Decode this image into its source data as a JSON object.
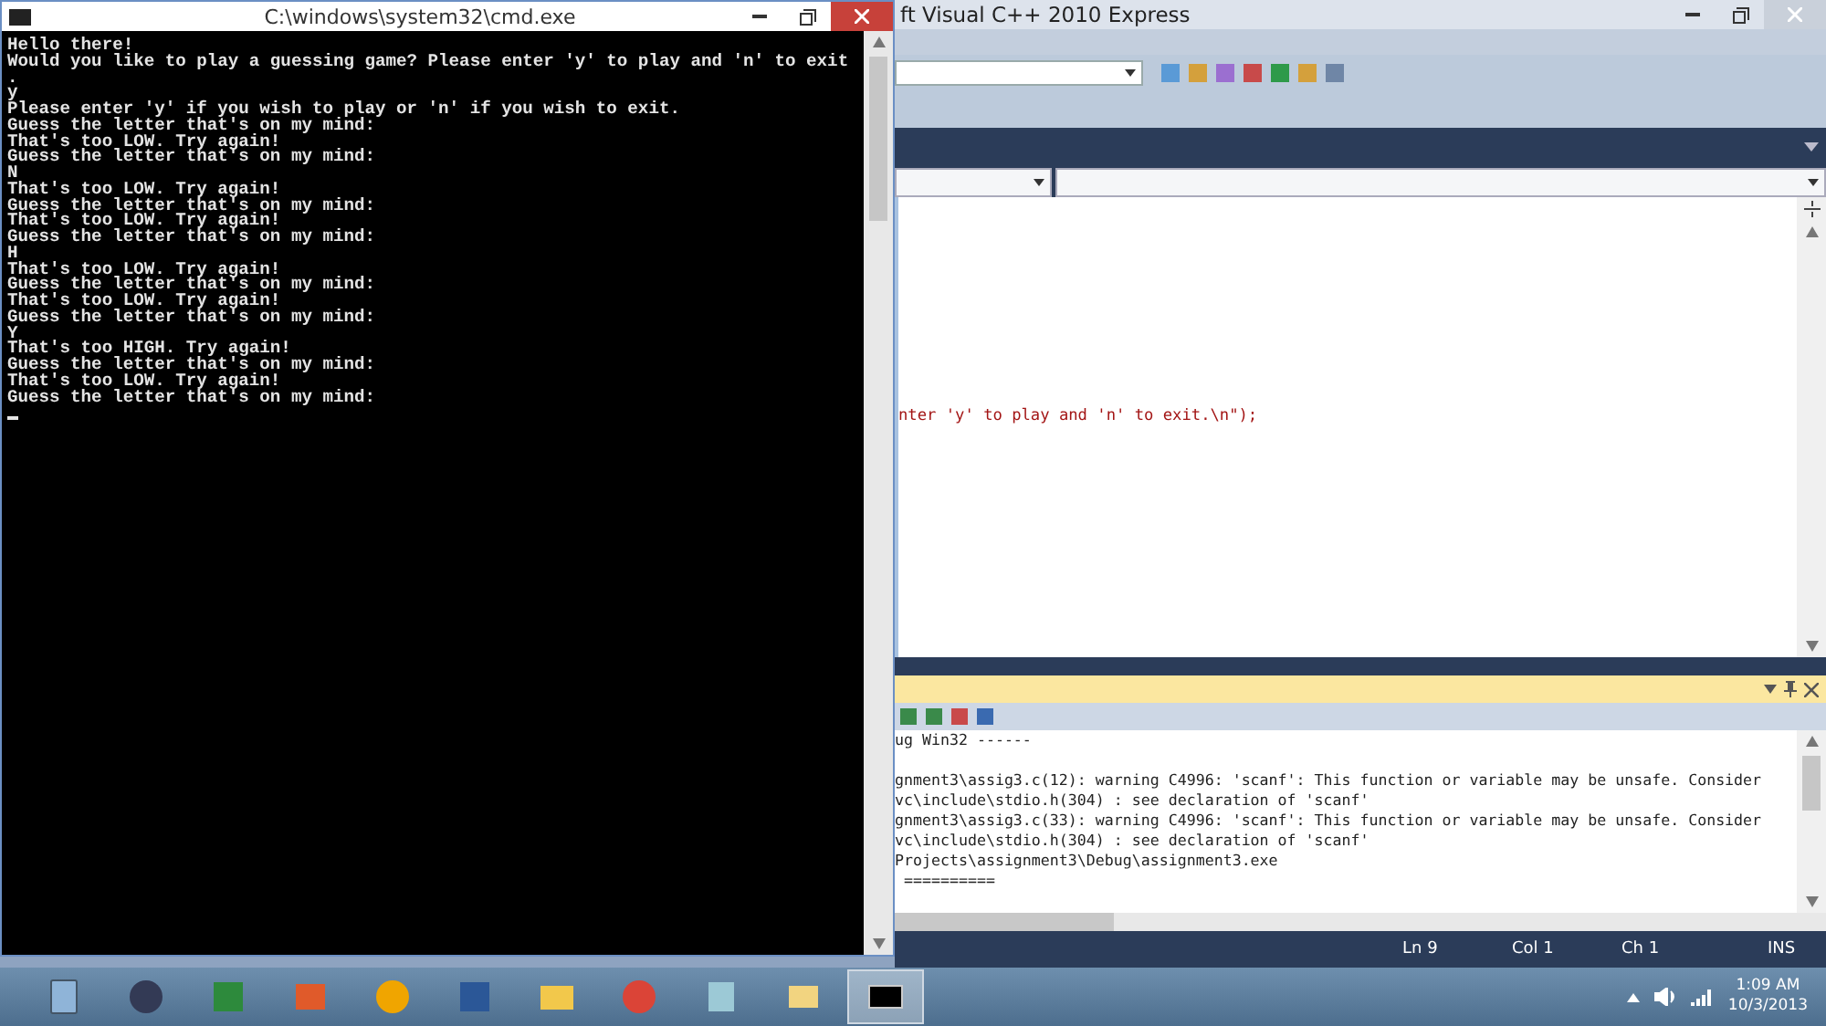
{
  "console_window": {
    "title": "C:\\windows\\system32\\cmd.exe",
    "lines": [
      "Hello there!",
      "Would you like to play a guessing game? Please enter 'y' to play and 'n' to exit",
      ".",
      "y",
      "Please enter 'y' if you wish to play or 'n' if you wish to exit.",
      "Guess the letter that's on my mind:",
      "That's too LOW. Try again!",
      "Guess the letter that's on my mind:",
      "N",
      "That's too LOW. Try again!",
      "Guess the letter that's on my mind:",
      "That's too LOW. Try again!",
      "Guess the letter that's on my mind:",
      "H",
      "That's too LOW. Try again!",
      "Guess the letter that's on my mind:",
      "That's too LOW. Try again!",
      "Guess the letter that's on my mind:",
      "Y",
      "That's too HIGH. Try again!",
      "Guess the letter that's on my mind:",
      "That's too LOW. Try again!",
      "Guess the letter that's on my mind:"
    ]
  },
  "ide_window": {
    "title": "ft Visual C++ 2010 Express",
    "code_line": "nter 'y' to play and 'n' to exit.\\n\");",
    "output_lines": [
      "ug Win32 ------",
      "gnment3\\assig3.c(12): warning C4996: 'scanf': This function or variable may be unsafe. Consider",
      "vc\\include\\stdio.h(304) : see declaration of 'scanf'",
      "gnment3\\assig3.c(33): warning C4996: 'scanf': This function or variable may be unsafe. Consider",
      "vc\\include\\stdio.h(304) : see declaration of 'scanf'",
      "Projects\\assignment3\\Debug\\assignment3.exe",
      " =========="
    ],
    "status_bar": [
      "Ln 9",
      "Col 1",
      "Ch 1",
      "INS"
    ]
  },
  "taskbar": {
    "apps": [
      {
        "selected": false
      },
      {
        "selected": false
      },
      {
        "selected": false
      },
      {
        "selected": false
      },
      {
        "selected": false
      },
      {
        "selected": false
      },
      {
        "selected": false
      },
      {
        "selected": false
      },
      {
        "selected": false
      },
      {
        "selected": false
      },
      {
        "selected": true
      }
    ],
    "clock": {
      "time": "1:09 AM",
      "date": "10/3/2013"
    }
  }
}
